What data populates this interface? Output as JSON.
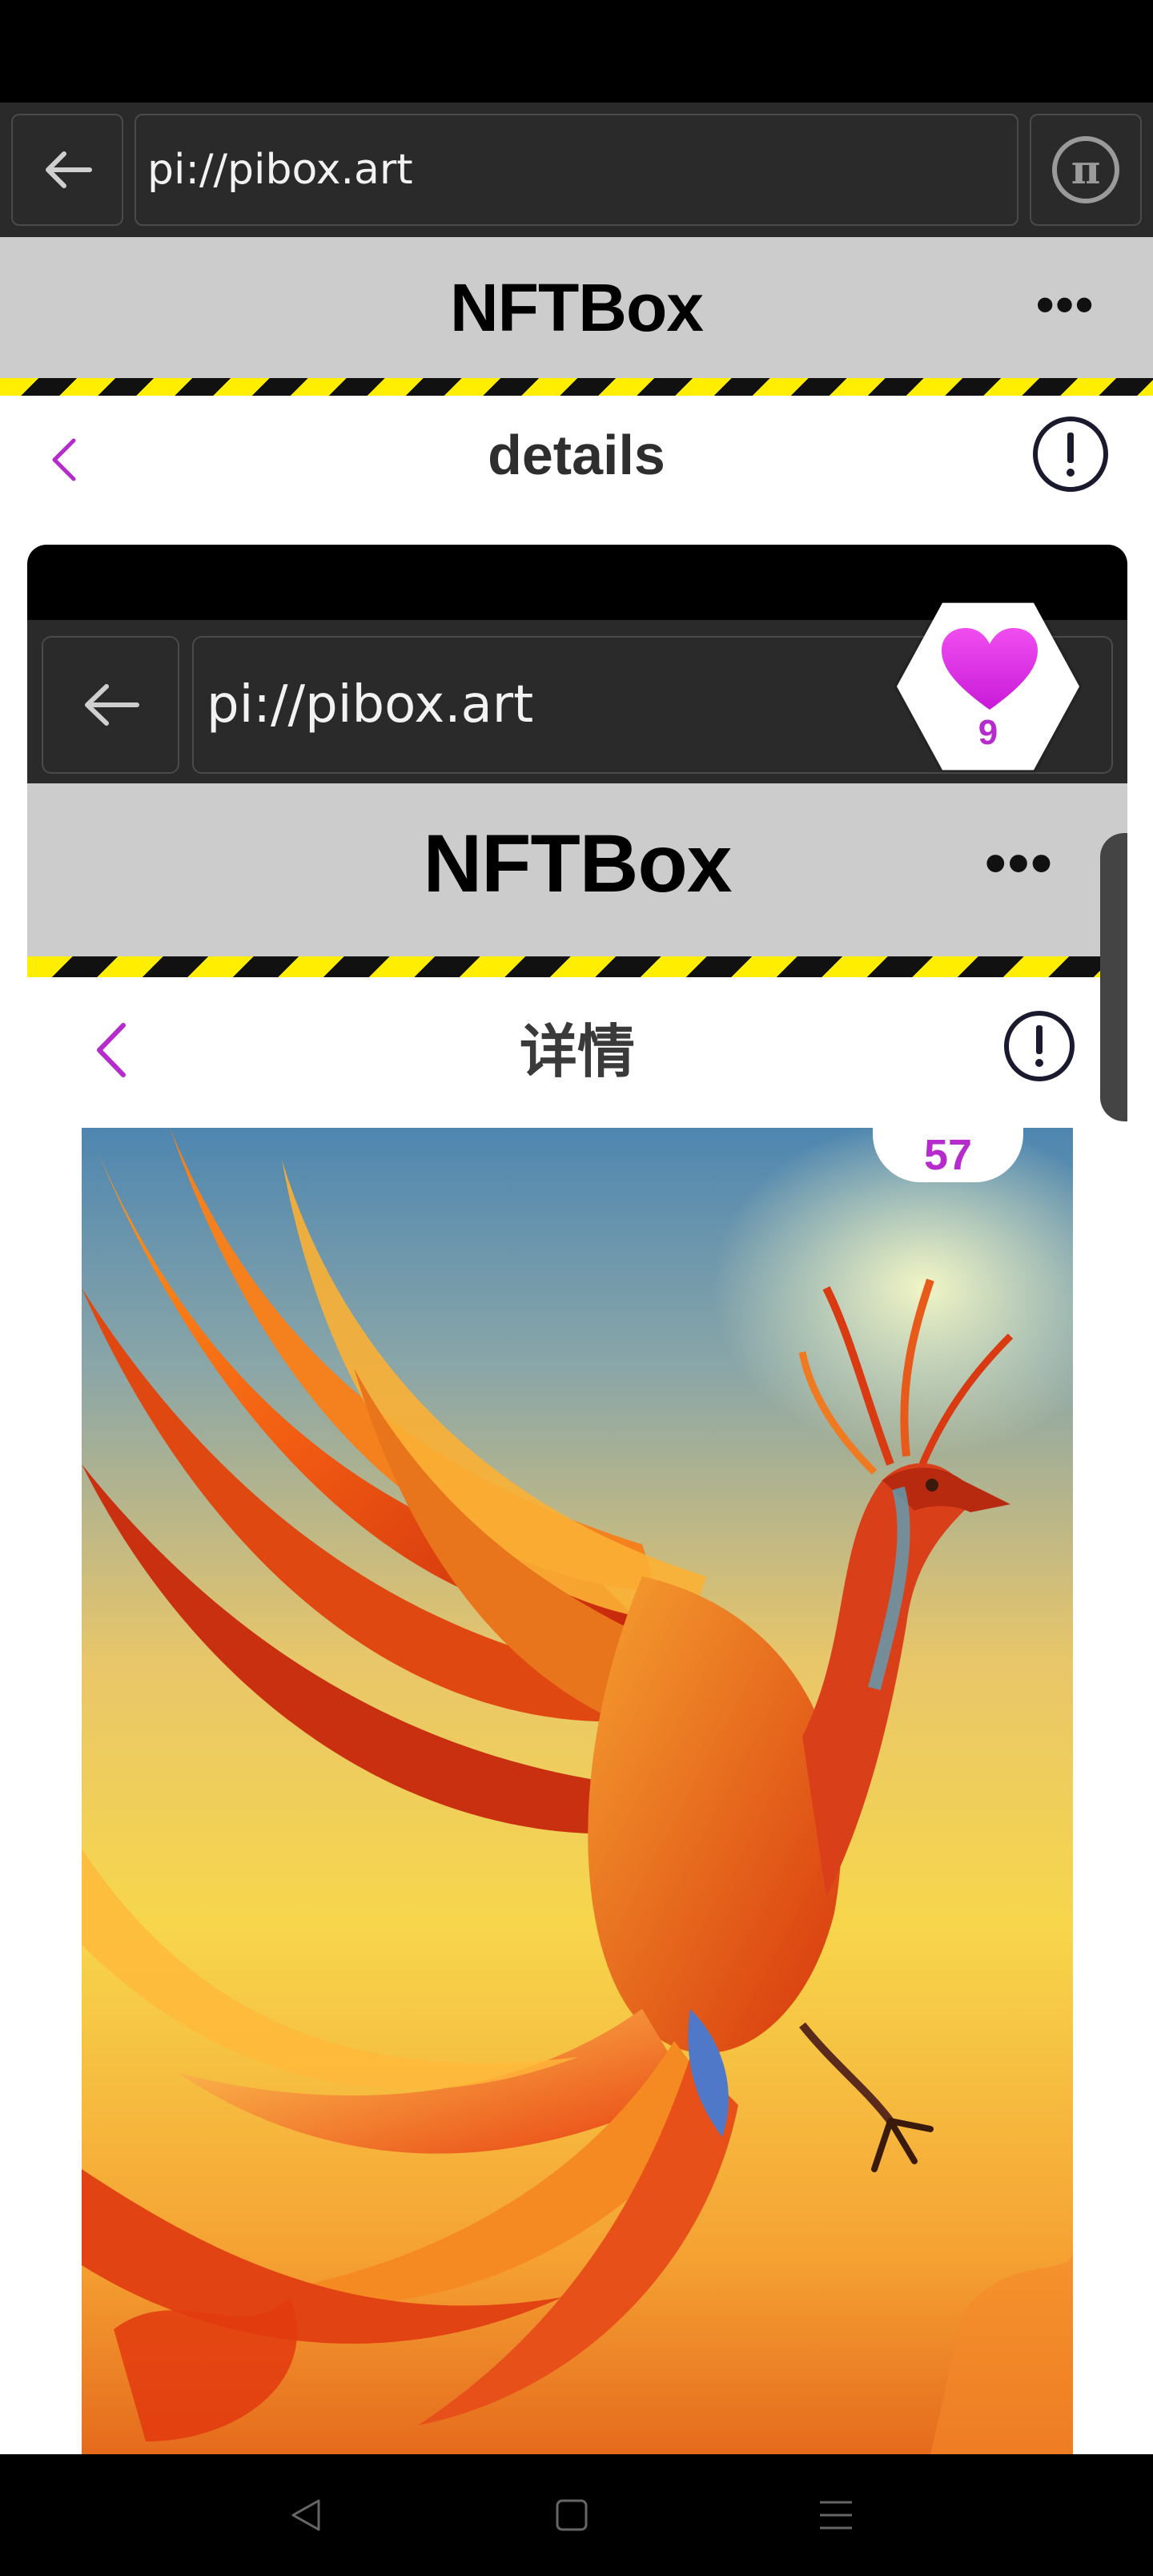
{
  "browser": {
    "url": "pi://pibox.art"
  },
  "app": {
    "title": "NFTBox",
    "more_label": "•••"
  },
  "details_page": {
    "title": "details"
  },
  "embedded_screenshot": {
    "url": "pi://pibox.art",
    "app_title": "NFTBox",
    "more_label": "•••",
    "details_title": "详情",
    "artwork_like_count": "57"
  },
  "like_badge": {
    "count": "9"
  },
  "colors": {
    "accent_purple": "#b52bcc",
    "heart_magenta": "#e020e0",
    "header_gray": "#cccccc",
    "hazard_yellow": "#ffee00"
  },
  "icons": {
    "back": "arrow-left-icon",
    "pi": "pi-coin-icon",
    "more": "more-horizontal-icon",
    "chevron": "chevron-left-icon",
    "info": "exclamation-circle-icon",
    "heart": "heart-icon"
  }
}
